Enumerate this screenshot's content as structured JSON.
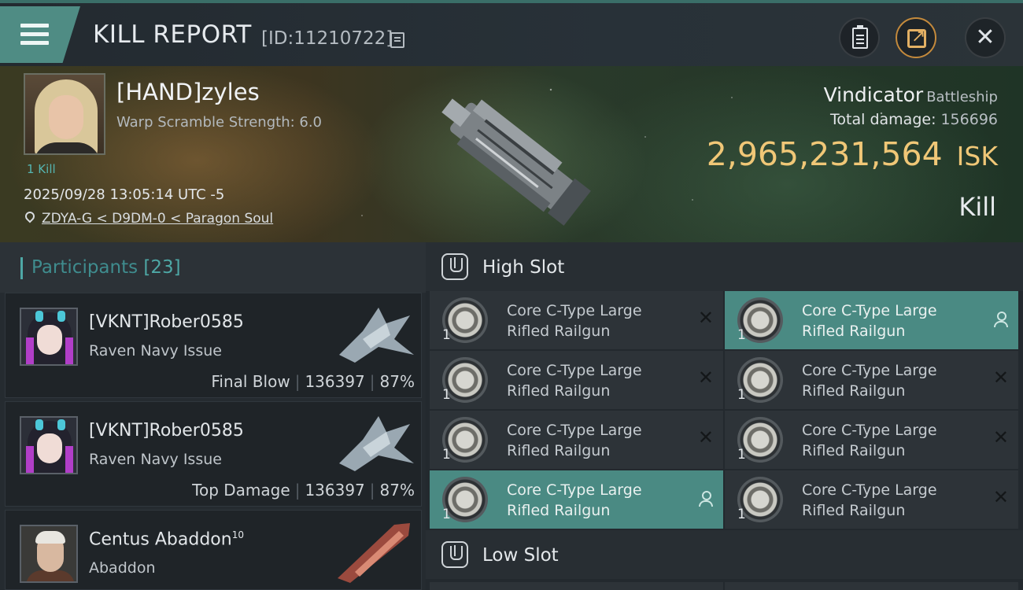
{
  "header": {
    "title": "KILL REPORT",
    "report_id": "[ID:11210722]"
  },
  "victim": {
    "name": "[HAND]zyles",
    "warp_scramble": "Warp Scramble Strength: 6.0",
    "kills_label": "1 Kill",
    "timestamp": "2025/09/28 13:05:14 UTC -5",
    "location": "ZDYA-G < D9DM-0 < Paragon Soul"
  },
  "ship": {
    "name": "Vindicator",
    "class": "Battleship",
    "total_damage_label": "Total damage:",
    "total_damage": "156696",
    "isk_value": "2,965,231,564",
    "currency": "ISK",
    "result": "Kill"
  },
  "participants": {
    "label": "Participants",
    "count": "[23]",
    "items": [
      {
        "name": "[VKNT]Rober0585",
        "ship": "Raven Navy Issue",
        "tag": "Final Blow",
        "damage": "136397",
        "percent": "87%"
      },
      {
        "name": "[VKNT]Rober0585",
        "ship": "Raven Navy Issue",
        "tag": "Top Damage",
        "damage": "136397",
        "percent": "87%"
      },
      {
        "name": "Centus Abaddon",
        "level": "10",
        "ship": "Abaddon"
      }
    ]
  },
  "slots": {
    "high_label": "High Slot",
    "low_label": "Low Slot",
    "high_modules": [
      {
        "name": "Core C-Type Large Rifled Railgun",
        "qty": "1",
        "status": "destroyed"
      },
      {
        "name": "Core C-Type Large Rifled Railgun",
        "qty": "1",
        "status": "dropped"
      },
      {
        "name": "Core C-Type Large Rifled Railgun",
        "qty": "1",
        "status": "destroyed"
      },
      {
        "name": "Core C-Type Large Rifled Railgun",
        "qty": "1",
        "status": "destroyed"
      },
      {
        "name": "Core C-Type Large Rifled Railgun",
        "qty": "1",
        "status": "destroyed"
      },
      {
        "name": "Core C-Type Large Rifled Railgun",
        "qty": "1",
        "status": "destroyed"
      },
      {
        "name": "Core C-Type Large Rifled Railgun",
        "qty": "1",
        "status": "dropped"
      },
      {
        "name": "Core C-Type Large Rifled Railgun",
        "qty": "1",
        "status": "destroyed"
      }
    ]
  },
  "colors": {
    "accent_teal": "#4f8c84",
    "isk_gold": "#f0c777",
    "highlight_row": "#4a8a83"
  },
  "icons": {
    "destroyed": "close-icon",
    "dropped": "user-icon",
    "slot": "turret-slot-icon"
  }
}
